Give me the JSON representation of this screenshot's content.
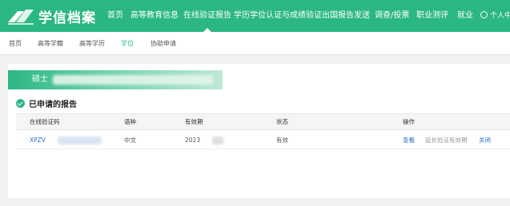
{
  "site": {
    "logo_text": "学信档案"
  },
  "nav": {
    "items": [
      {
        "label": "首页",
        "active": false
      },
      {
        "label": "高等教育信息",
        "active": false
      },
      {
        "label": "在线验证报告",
        "active": true
      },
      {
        "label": "学历学位认证与成绩验证",
        "active": false
      },
      {
        "label": "出国报告发送",
        "active": false
      },
      {
        "label": "调查/投票",
        "active": false
      },
      {
        "label": "职业测评",
        "active": false
      },
      {
        "label": "就业",
        "active": false
      }
    ],
    "user_label": "个人中"
  },
  "subnav": {
    "items": [
      {
        "label": "首页",
        "active": false
      },
      {
        "label": "高等学籍",
        "active": false
      },
      {
        "label": "高等学历",
        "active": false
      },
      {
        "label": "学位",
        "active": true
      },
      {
        "label": "协助申请",
        "active": false
      }
    ]
  },
  "degree": {
    "label": "硕士"
  },
  "section": {
    "title": "已申请的报告"
  },
  "table": {
    "headers": [
      "在线验证码",
      "语种",
      "有效期",
      "状态",
      "操作"
    ],
    "rows": [
      {
        "code": "XPZV",
        "language": "中文",
        "validity": "2023",
        "status": "有效",
        "actions": {
          "view": "查看",
          "extend": "延长验证有效期",
          "close": "关闭"
        }
      }
    ]
  },
  "colors": {
    "brand": "#2bb783",
    "link": "#2a6fc9",
    "muted": "#999999"
  }
}
